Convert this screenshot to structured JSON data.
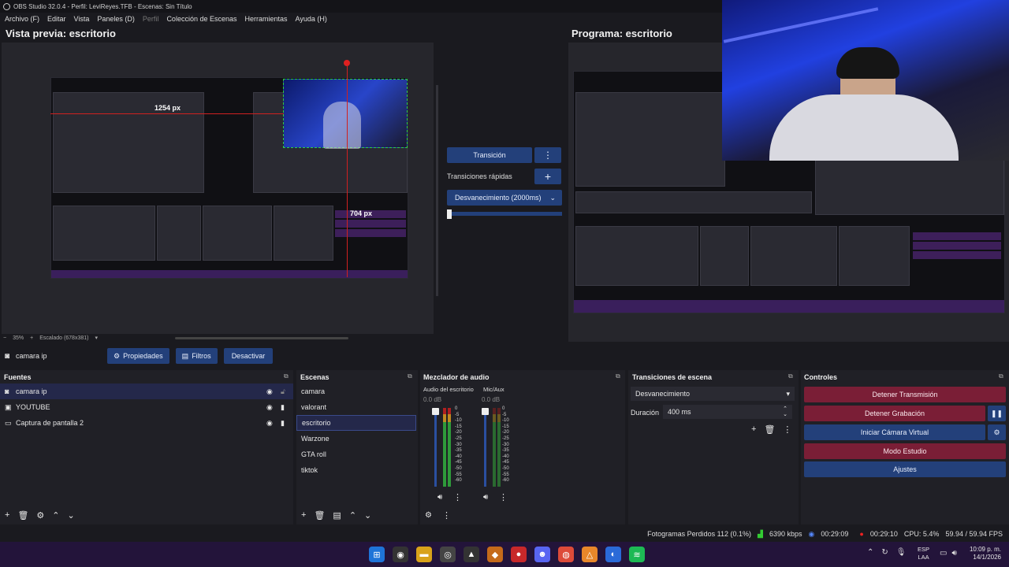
{
  "app": {
    "title": "OBS Studio 32.0.4 - Perfil: LeviReyes.TFB - Escenas: Sin Título",
    "menu": [
      "Archivo (F)",
      "Editar",
      "Vista",
      "Paneles (D)",
      "Perfil",
      "Colección de Escenas",
      "Herramientas",
      "Ayuda (H)"
    ]
  },
  "preview": {
    "title": "Vista previa: escritorio",
    "zoom_minus": "−",
    "zoom_value": "35%",
    "zoom_plus": "+",
    "scale_label": "Escalado (678x381)",
    "measure_width": "1254 px",
    "measure_height": "704 px"
  },
  "program": {
    "title": "Programa: escritorio"
  },
  "transition_panel": {
    "transition_button": "Transición",
    "quick_label": "Transiciones rápidas",
    "fade_option": "Desvanecimiento (2000ms)"
  },
  "source_toolbar": {
    "source_name": "camara ip",
    "properties": "Propiedades",
    "filters": "Filtros",
    "deactivate": "Desactivar"
  },
  "sources": {
    "title": "Fuentes",
    "items": [
      {
        "label": "camara ip",
        "icon": "camera-icon"
      },
      {
        "label": "YOUTUBE",
        "icon": "window-icon"
      },
      {
        "label": "Captura de pantalla 2",
        "icon": "monitor-icon"
      }
    ]
  },
  "scenes": {
    "title": "Escenas",
    "items": [
      "camara",
      "valorant",
      "escritorio",
      "Warzone",
      "GTA roll",
      "tiktok"
    ],
    "selected": "escritorio"
  },
  "mixer": {
    "title": "Mezclador de audio",
    "channels": [
      {
        "name": "Audio del escritorio",
        "db": "0.0 dB"
      },
      {
        "name": "Mic/Aux",
        "db": "0.0 dB"
      }
    ],
    "scale": [
      "0",
      "-5",
      "-10",
      "-15",
      "-20",
      "-25",
      "-30",
      "-35",
      "-40",
      "-45",
      "-50",
      "-55",
      "-60"
    ]
  },
  "scene_transitions": {
    "title": "Transiciones de escena",
    "selected": "Desvanecimiento",
    "duration_label": "Duración",
    "duration_value": "400 ms"
  },
  "controls": {
    "title": "Controles",
    "stop_stream": "Detener Transmisión",
    "stop_recording": "Detener Grabación",
    "virtual_cam": "Iniciar Cámara Virtual",
    "studio_mode": "Modo Estudio",
    "settings": "Ajustes"
  },
  "status": {
    "dropped_frames": "Fotogramas Perdidos 112 (0.1%)",
    "bitrate": "6390 kbps",
    "stream_time": "00:29:09",
    "rec_time": "00:29:10",
    "cpu": "CPU: 5.4%",
    "fps": "59.94 / 59.94 FPS"
  },
  "taskbar": {
    "lang_top": "ESP",
    "lang_bottom": "LAA",
    "time": "10:09 p. m.",
    "date": "14/1/2026"
  },
  "colors": {
    "blue_button": "#23407a",
    "red_button": "#7a1e36",
    "panel_bg": "#202026",
    "taskbar": "#23143a"
  }
}
